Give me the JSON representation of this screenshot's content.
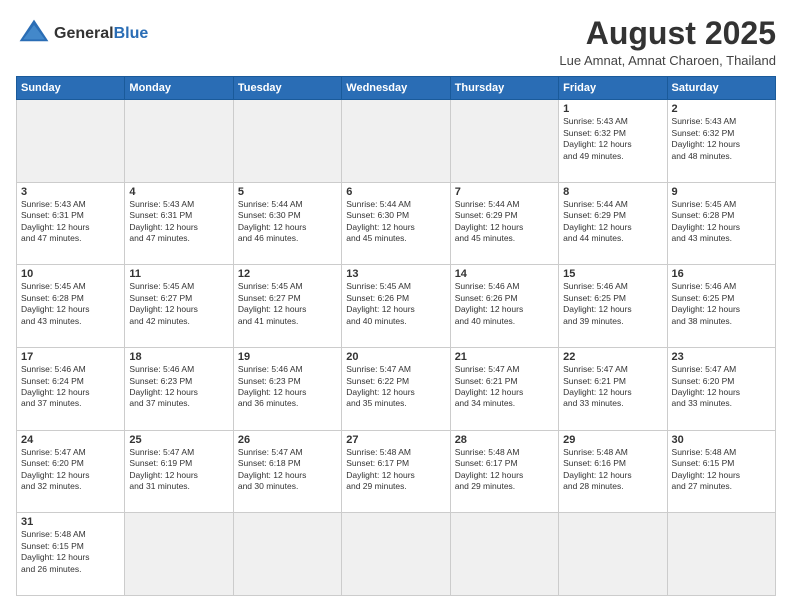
{
  "header": {
    "logo_general": "General",
    "logo_blue": "Blue",
    "month_year": "August 2025",
    "location": "Lue Amnat, Amnat Charoen, Thailand"
  },
  "weekdays": [
    "Sunday",
    "Monday",
    "Tuesday",
    "Wednesday",
    "Thursday",
    "Friday",
    "Saturday"
  ],
  "weeks": [
    [
      {
        "day": "",
        "info": ""
      },
      {
        "day": "",
        "info": ""
      },
      {
        "day": "",
        "info": ""
      },
      {
        "day": "",
        "info": ""
      },
      {
        "day": "",
        "info": ""
      },
      {
        "day": "1",
        "info": "Sunrise: 5:43 AM\nSunset: 6:32 PM\nDaylight: 12 hours\nand 49 minutes."
      },
      {
        "day": "2",
        "info": "Sunrise: 5:43 AM\nSunset: 6:32 PM\nDaylight: 12 hours\nand 48 minutes."
      }
    ],
    [
      {
        "day": "3",
        "info": "Sunrise: 5:43 AM\nSunset: 6:31 PM\nDaylight: 12 hours\nand 47 minutes."
      },
      {
        "day": "4",
        "info": "Sunrise: 5:43 AM\nSunset: 6:31 PM\nDaylight: 12 hours\nand 47 minutes."
      },
      {
        "day": "5",
        "info": "Sunrise: 5:44 AM\nSunset: 6:30 PM\nDaylight: 12 hours\nand 46 minutes."
      },
      {
        "day": "6",
        "info": "Sunrise: 5:44 AM\nSunset: 6:30 PM\nDaylight: 12 hours\nand 45 minutes."
      },
      {
        "day": "7",
        "info": "Sunrise: 5:44 AM\nSunset: 6:29 PM\nDaylight: 12 hours\nand 45 minutes."
      },
      {
        "day": "8",
        "info": "Sunrise: 5:44 AM\nSunset: 6:29 PM\nDaylight: 12 hours\nand 44 minutes."
      },
      {
        "day": "9",
        "info": "Sunrise: 5:45 AM\nSunset: 6:28 PM\nDaylight: 12 hours\nand 43 minutes."
      }
    ],
    [
      {
        "day": "10",
        "info": "Sunrise: 5:45 AM\nSunset: 6:28 PM\nDaylight: 12 hours\nand 43 minutes."
      },
      {
        "day": "11",
        "info": "Sunrise: 5:45 AM\nSunset: 6:27 PM\nDaylight: 12 hours\nand 42 minutes."
      },
      {
        "day": "12",
        "info": "Sunrise: 5:45 AM\nSunset: 6:27 PM\nDaylight: 12 hours\nand 41 minutes."
      },
      {
        "day": "13",
        "info": "Sunrise: 5:45 AM\nSunset: 6:26 PM\nDaylight: 12 hours\nand 40 minutes."
      },
      {
        "day": "14",
        "info": "Sunrise: 5:46 AM\nSunset: 6:26 PM\nDaylight: 12 hours\nand 40 minutes."
      },
      {
        "day": "15",
        "info": "Sunrise: 5:46 AM\nSunset: 6:25 PM\nDaylight: 12 hours\nand 39 minutes."
      },
      {
        "day": "16",
        "info": "Sunrise: 5:46 AM\nSunset: 6:25 PM\nDaylight: 12 hours\nand 38 minutes."
      }
    ],
    [
      {
        "day": "17",
        "info": "Sunrise: 5:46 AM\nSunset: 6:24 PM\nDaylight: 12 hours\nand 37 minutes."
      },
      {
        "day": "18",
        "info": "Sunrise: 5:46 AM\nSunset: 6:23 PM\nDaylight: 12 hours\nand 37 minutes."
      },
      {
        "day": "19",
        "info": "Sunrise: 5:46 AM\nSunset: 6:23 PM\nDaylight: 12 hours\nand 36 minutes."
      },
      {
        "day": "20",
        "info": "Sunrise: 5:47 AM\nSunset: 6:22 PM\nDaylight: 12 hours\nand 35 minutes."
      },
      {
        "day": "21",
        "info": "Sunrise: 5:47 AM\nSunset: 6:21 PM\nDaylight: 12 hours\nand 34 minutes."
      },
      {
        "day": "22",
        "info": "Sunrise: 5:47 AM\nSunset: 6:21 PM\nDaylight: 12 hours\nand 33 minutes."
      },
      {
        "day": "23",
        "info": "Sunrise: 5:47 AM\nSunset: 6:20 PM\nDaylight: 12 hours\nand 33 minutes."
      }
    ],
    [
      {
        "day": "24",
        "info": "Sunrise: 5:47 AM\nSunset: 6:20 PM\nDaylight: 12 hours\nand 32 minutes."
      },
      {
        "day": "25",
        "info": "Sunrise: 5:47 AM\nSunset: 6:19 PM\nDaylight: 12 hours\nand 31 minutes."
      },
      {
        "day": "26",
        "info": "Sunrise: 5:47 AM\nSunset: 6:18 PM\nDaylight: 12 hours\nand 30 minutes."
      },
      {
        "day": "27",
        "info": "Sunrise: 5:48 AM\nSunset: 6:17 PM\nDaylight: 12 hours\nand 29 minutes."
      },
      {
        "day": "28",
        "info": "Sunrise: 5:48 AM\nSunset: 6:17 PM\nDaylight: 12 hours\nand 29 minutes."
      },
      {
        "day": "29",
        "info": "Sunrise: 5:48 AM\nSunset: 6:16 PM\nDaylight: 12 hours\nand 28 minutes."
      },
      {
        "day": "30",
        "info": "Sunrise: 5:48 AM\nSunset: 6:15 PM\nDaylight: 12 hours\nand 27 minutes."
      }
    ],
    [
      {
        "day": "31",
        "info": "Sunrise: 5:48 AM\nSunset: 6:15 PM\nDaylight: 12 hours\nand 26 minutes."
      },
      {
        "day": "",
        "info": ""
      },
      {
        "day": "",
        "info": ""
      },
      {
        "day": "",
        "info": ""
      },
      {
        "day": "",
        "info": ""
      },
      {
        "day": "",
        "info": ""
      },
      {
        "day": "",
        "info": ""
      }
    ]
  ]
}
